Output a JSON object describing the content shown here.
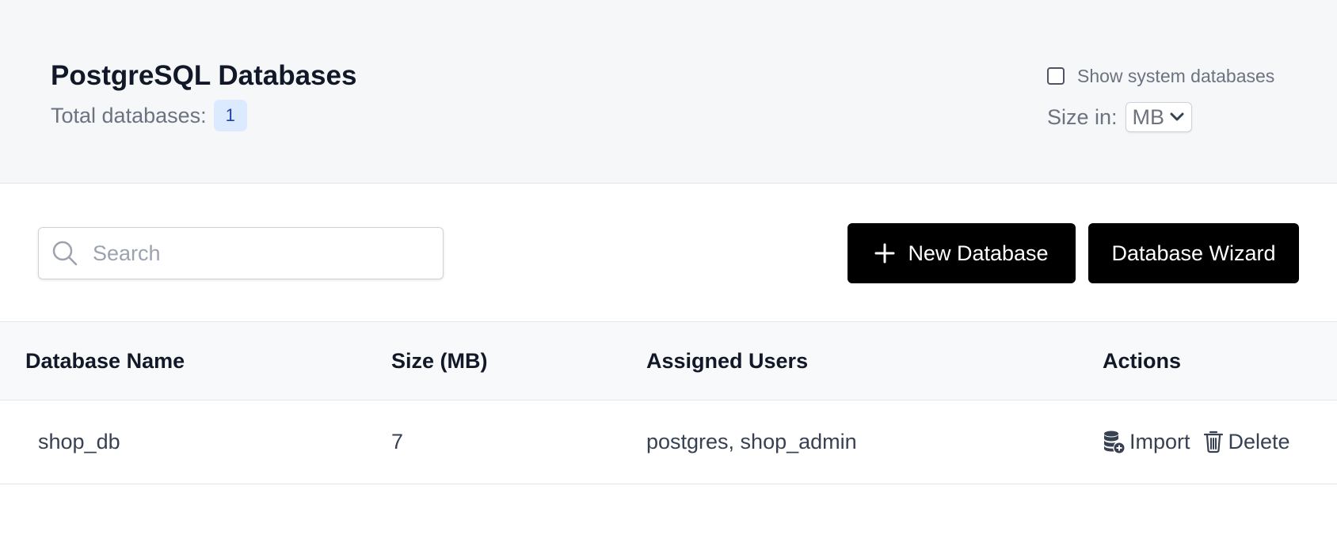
{
  "header": {
    "title": "PostgreSQL Databases",
    "total_label": "Total databases:",
    "total_count": "1",
    "show_system_label": "Show system databases",
    "show_system_checked": false,
    "size_in_label": "Size in:",
    "size_unit_selected": "MB"
  },
  "toolbar": {
    "search_placeholder": "Search",
    "search_value": "",
    "new_database_label": "New Database",
    "wizard_label": "Database Wizard"
  },
  "table": {
    "columns": [
      "Database Name",
      "Size (MB)",
      "Assigned Users",
      "Actions"
    ],
    "rows": [
      {
        "name": "shop_db",
        "size": "7",
        "users": "postgres, shop_admin",
        "actions": [
          "Import",
          "Delete"
        ]
      }
    ]
  },
  "icons": {
    "search": "search-icon",
    "plus": "plus-icon",
    "chevron": "chevron-down-icon",
    "import": "database-import-icon",
    "delete": "trash-icon"
  },
  "colors": {
    "header_bg": "#f6f7f9",
    "button_bg": "#000000",
    "badge_bg": "#dbeafe",
    "badge_text": "#1e40af"
  }
}
